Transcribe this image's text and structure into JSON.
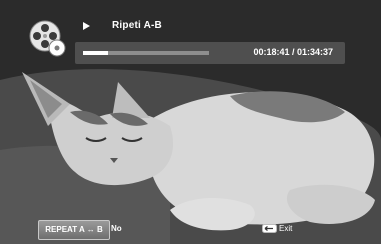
{
  "osd": {
    "mode_title": "Ripeti  A-B",
    "time_display": "00:18:41 / 01:34:37",
    "progress": 0.2
  },
  "footer": {
    "repeat_button_label": "REPEAT A ↔ B",
    "repeat_value": "No",
    "exit_label": "Exit"
  },
  "icons": {
    "disc": "disc-icon",
    "play": "play-icon",
    "exit_key": "return-key-icon"
  }
}
